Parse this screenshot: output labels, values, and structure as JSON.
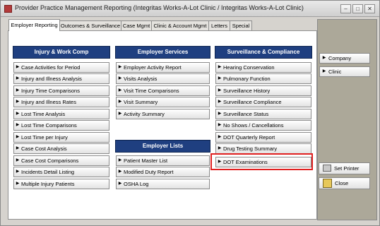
{
  "window": {
    "title": "Provider Practice Management Reporting (Integritas Works-A-Lot Clinic / Integritas Works-A-Lot Clinic)"
  },
  "tabs": [
    {
      "label": "Employer Reporting",
      "active": true
    },
    {
      "label": "Outcomes & Surveillance"
    },
    {
      "label": "Case Mgmt"
    },
    {
      "label": "Clinic & Account Mgmt"
    },
    {
      "label": "Letters"
    },
    {
      "label": "Special"
    }
  ],
  "sections": {
    "injury_work_comp": {
      "title": "Injury & Work Comp",
      "items": [
        "Case Activities for Period",
        "Injury and Illness Analysis",
        "Injury Time Comparisons",
        "Injury and Illness Rates",
        "Lost Time Analysis",
        "Lost Time Comparisons",
        "Lost Time per Injury",
        "Case Cost Analysis",
        "Case Cost Comparisons",
        "Incidents Detail Listing",
        "Multiple Injury Patients"
      ]
    },
    "employer_services": {
      "title": "Employer Services",
      "items": [
        "Employer Activity Report",
        "Visits Analysis",
        "Visit Time Comparisons",
        "Visit Summary",
        "Activity Summary"
      ]
    },
    "employer_lists": {
      "title": "Employer Lists",
      "items": [
        "Patient Master List",
        "Modified Duty Report",
        "OSHA Log"
      ]
    },
    "surveillance_compliance": {
      "title": "Surveillance & Compliance",
      "items": [
        "Hearing Conservation",
        "Pulmonary Function",
        "Surveillance History",
        "Surveillance Compliance",
        "Surveillance Status",
        "No Shows / Cancellations",
        "DOT Quarterly Report",
        "Drug Testing Summary",
        "DOT Examinations"
      ]
    }
  },
  "sidebar": {
    "company_label": "Company",
    "clinic_label": "Clinic",
    "set_printer_label": "Set Printer",
    "close_label": "Close"
  },
  "colors": {
    "header_bg": "#1f3f80",
    "highlight": "#e02020",
    "side_panel": "#aca899"
  }
}
